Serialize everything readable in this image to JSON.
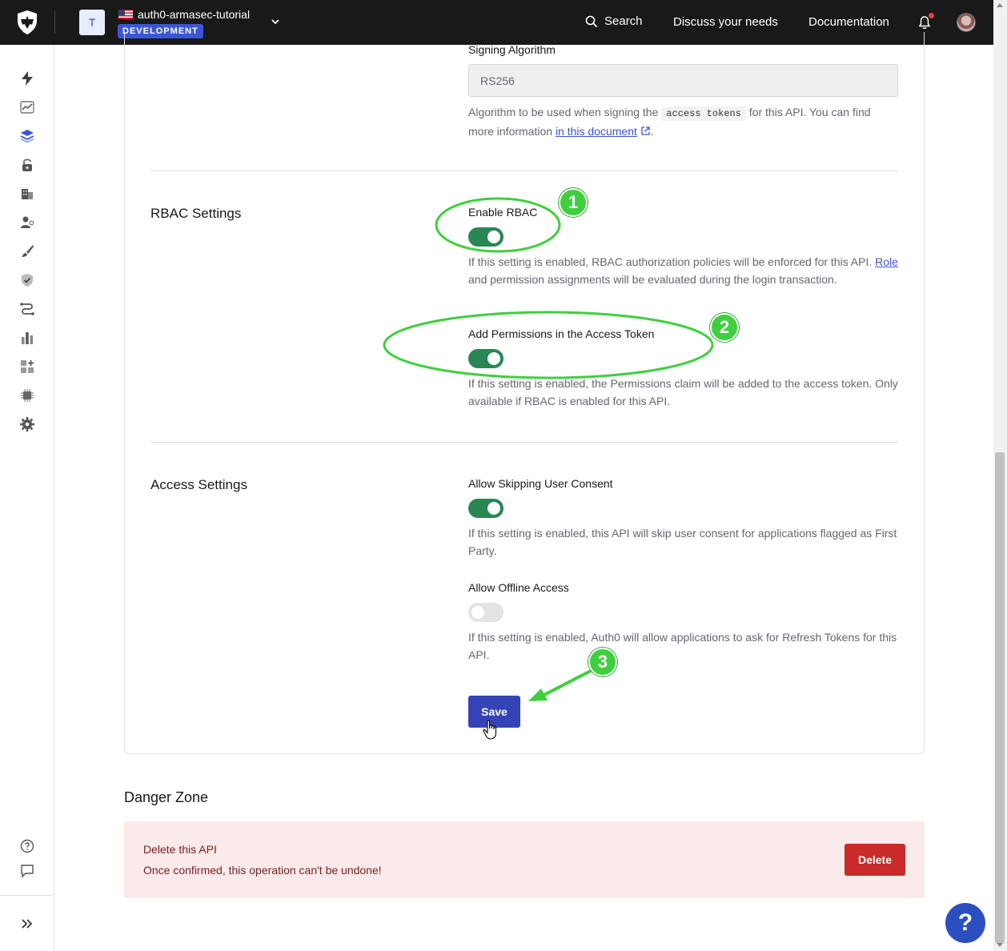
{
  "header": {
    "tenant_initial": "T",
    "tenant_name": "auth0-armasec-tutorial",
    "environment": "DEVELOPMENT",
    "search_label": "Search",
    "discuss_label": "Discuss your needs",
    "docs_label": "Documentation",
    "has_notification": true
  },
  "sidebar": {
    "items": [
      {
        "icon": "lightning-icon"
      },
      {
        "icon": "activity-chart-icon"
      },
      {
        "icon": "layers-icon"
      },
      {
        "icon": "lock-icon"
      },
      {
        "icon": "organizations-icon"
      },
      {
        "icon": "user-management-icon"
      },
      {
        "icon": "branding-brush-icon"
      },
      {
        "icon": "security-shield-icon"
      },
      {
        "icon": "actions-flow-icon"
      },
      {
        "icon": "monitoring-bars-icon"
      },
      {
        "icon": "marketplace-icon"
      },
      {
        "icon": "extensions-chip-icon"
      },
      {
        "icon": "settings-gear-icon"
      }
    ],
    "bottom": [
      {
        "icon": "help-circle-icon"
      },
      {
        "icon": "feedback-chat-icon"
      },
      {
        "icon": "expand-sidebar-icon"
      }
    ]
  },
  "signing": {
    "label": "Signing Algorithm",
    "value": "RS256",
    "help_prefix": "Algorithm to be used when signing the",
    "help_code": "access tokens",
    "help_middle": "for this API. You can find more information",
    "help_link": "in this document",
    "help_suffix": "."
  },
  "rbac": {
    "title": "RBAC Settings",
    "enable_label": "Enable RBAC",
    "enable_on": true,
    "enable_help_1": "If this setting is enabled, RBAC authorization policies will be enforced for this API.",
    "enable_help_link": "Role",
    "enable_help_2": "and permission assignments will be evaluated during the login transaction.",
    "perm_label": "Add Permissions in the Access Token",
    "perm_on": true,
    "perm_help": "If this setting is enabled, the Permissions claim will be added to the access token. Only available if RBAC is enabled for this API."
  },
  "access": {
    "title": "Access Settings",
    "skip_label": "Allow Skipping User Consent",
    "skip_on": true,
    "skip_help": "If this setting is enabled, this API will skip user consent for applications flagged as First Party.",
    "offline_label": "Allow Offline Access",
    "offline_on": false,
    "offline_help": "If this setting is enabled, Auth0 will allow applications to ask for Refresh Tokens for this API.",
    "save_label": "Save"
  },
  "danger": {
    "title": "Danger Zone",
    "heading": "Delete this API",
    "text": "Once confirmed, this operation can't be undone!",
    "delete_label": "Delete"
  },
  "annotations": {
    "steps": [
      "1",
      "2",
      "3"
    ],
    "color": "#3ecf3e"
  },
  "help_fab_label": "?"
}
